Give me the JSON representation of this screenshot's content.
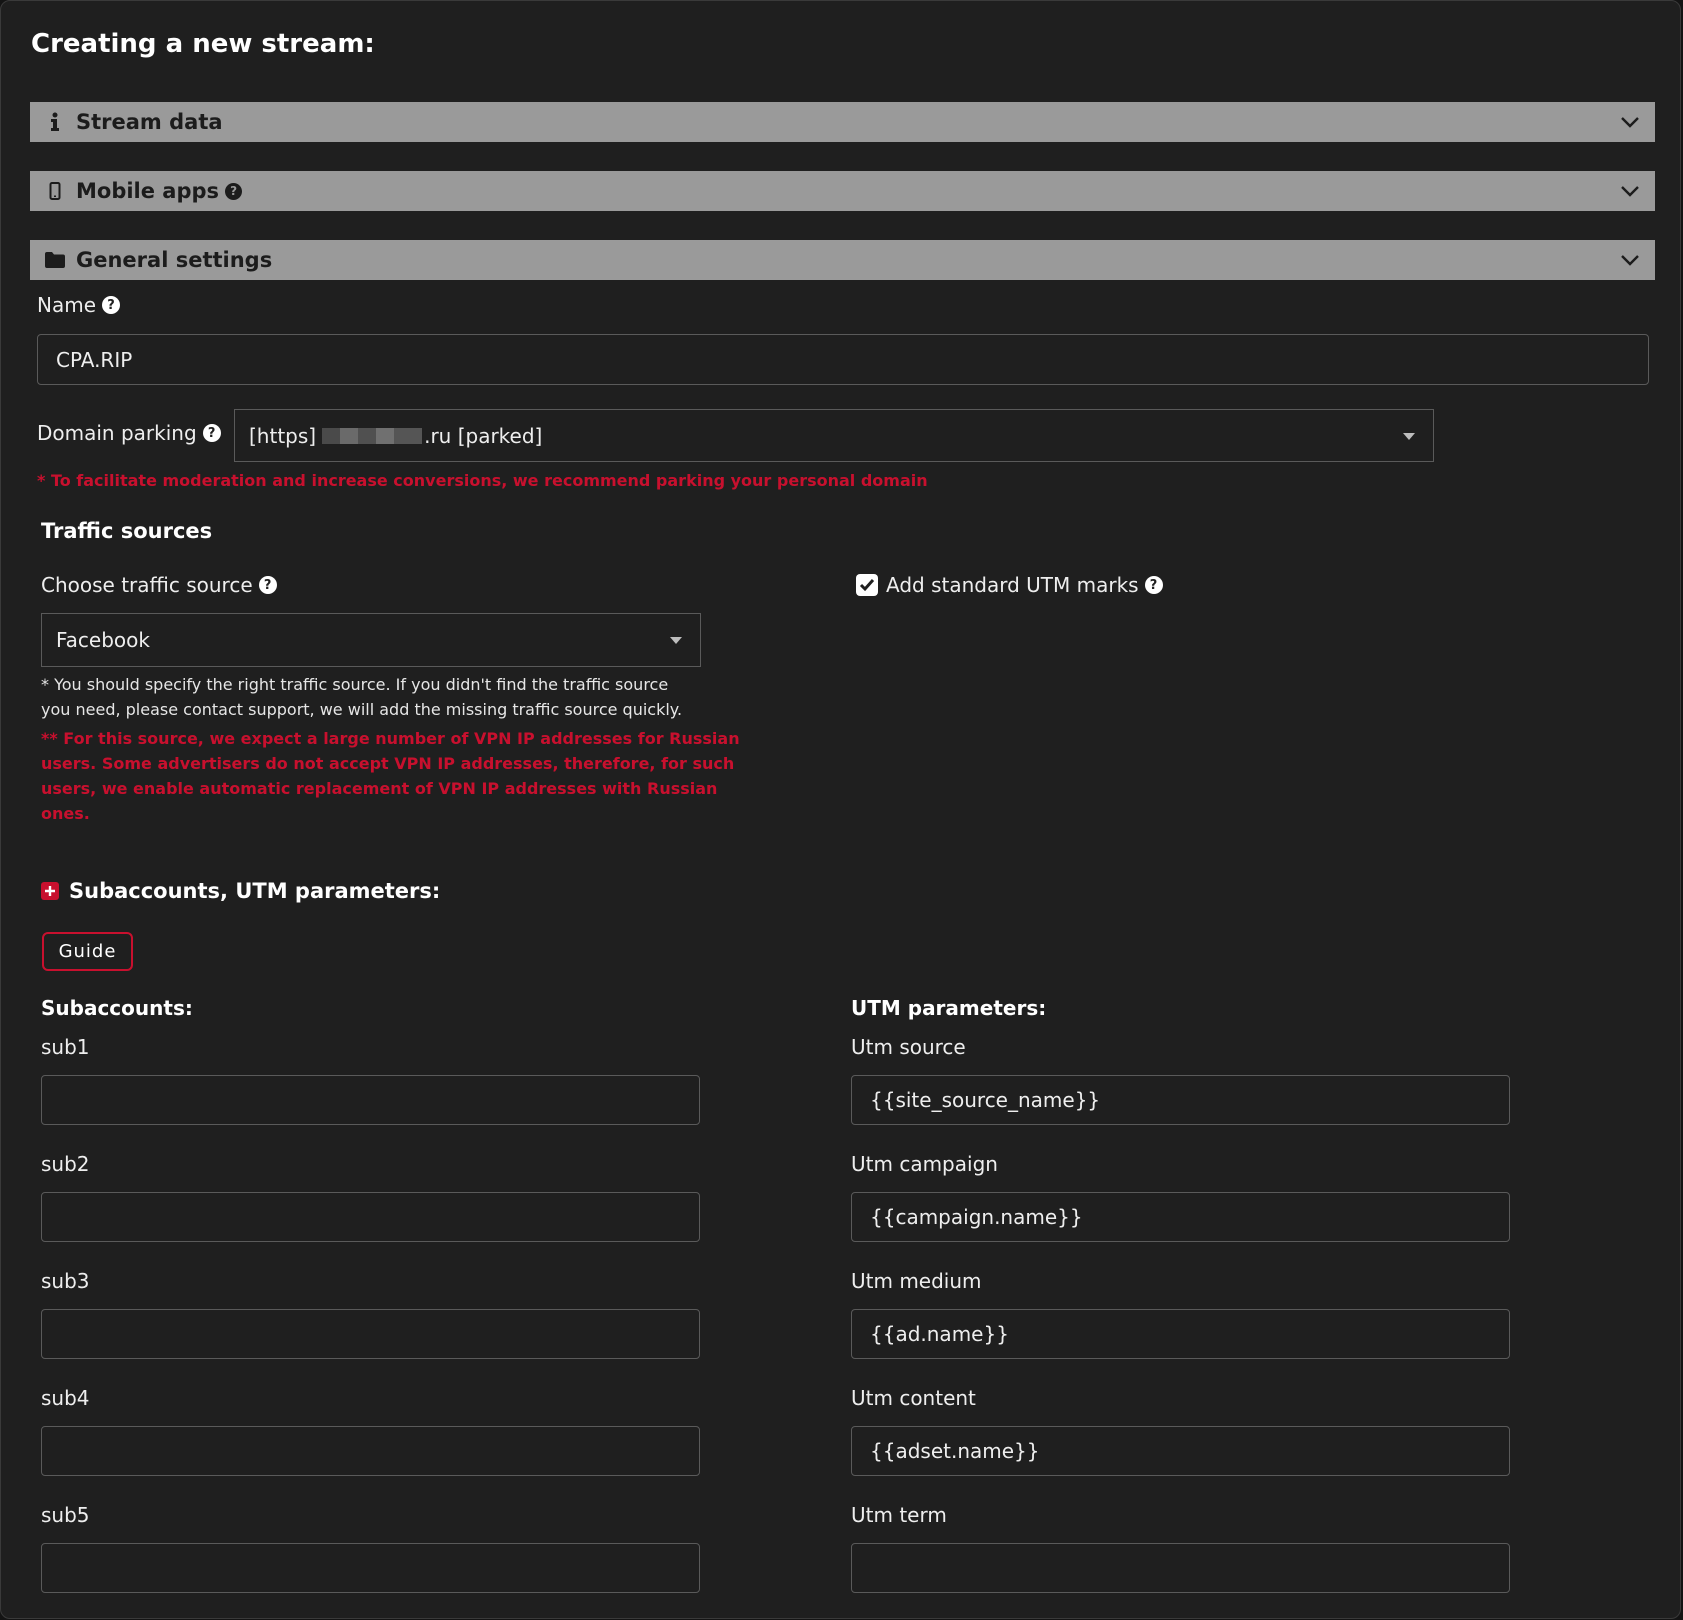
{
  "page": {
    "title": "Creating a new stream:"
  },
  "accordions": {
    "stream_data": {
      "label": "Stream data",
      "icon": "info-icon"
    },
    "mobile_apps": {
      "label": "Mobile apps",
      "icon": "mobile-icon"
    },
    "general_settings": {
      "label": "General settings",
      "icon": "folder-icon"
    }
  },
  "general": {
    "name_label": "Name",
    "name_value": "CPA.RIP",
    "domain_label": "Domain parking",
    "domain_prefix": "[https]",
    "domain_suffix": ".ru [parked]",
    "domain_note": "* To facilitate moderation and increase conversions, we recommend parking your personal domain"
  },
  "traffic": {
    "title": "Traffic sources",
    "choose_label": "Choose traffic source",
    "selected": "Facebook",
    "utm_checkbox_label": "Add standard UTM marks",
    "utm_checked": true,
    "note_line1": "* You should specify the right traffic source. If you didn't find the traffic source",
    "note_line2": "you need, please contact support, we will add the missing traffic source quickly.",
    "vpn_line1": "** For this source, we expect a large number of VPN IP addresses for Russian",
    "vpn_line2": "users. Some advertisers do not accept VPN IP addresses, therefore, for such",
    "vpn_line3": "users, we enable automatic replacement of VPN IP addresses with Russian",
    "vpn_line4": "ones."
  },
  "subaccounts_section": {
    "title": "Subaccounts, UTM parameters:",
    "guide_label": "Guide",
    "subaccounts_title": "Subaccounts:",
    "utm_title": "UTM parameters:"
  },
  "subaccounts": [
    {
      "label": "sub1",
      "value": ""
    },
    {
      "label": "sub2",
      "value": ""
    },
    {
      "label": "sub3",
      "value": ""
    },
    {
      "label": "sub4",
      "value": ""
    },
    {
      "label": "sub5",
      "value": ""
    }
  ],
  "utm": [
    {
      "label": "Utm source",
      "value": "{{site_source_name}}"
    },
    {
      "label": "Utm campaign",
      "value": "{{campaign.name}}"
    },
    {
      "label": "Utm medium",
      "value": "{{ad.name}}"
    },
    {
      "label": "Utm content",
      "value": "{{adset.name}}"
    },
    {
      "label": "Utm term",
      "value": ""
    }
  ],
  "colors": {
    "background": "#1f1f1f",
    "accordion_bar": "#9a9a9a",
    "accent_red": "#c8102e"
  }
}
